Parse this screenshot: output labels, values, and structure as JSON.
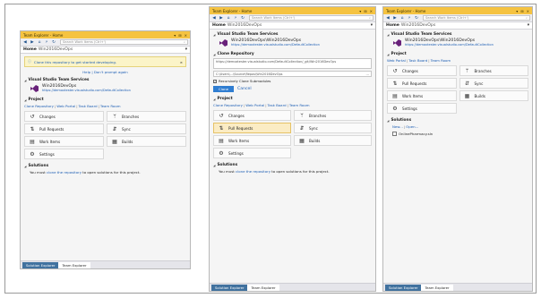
{
  "colors": {
    "title_bar": "#f5c341",
    "accent": "#2f7dd1",
    "link": "#1e5fb4",
    "tab_inactive": "#41729f",
    "selected_tile": "#fbecc4"
  },
  "panel1": {
    "title": "Team Explorer - Home",
    "search_placeholder": "Search Work Items (Ctrl+')",
    "home_label": "Home",
    "home_project": "Win2016DevOps",
    "notice": {
      "text": "Clone this repository to get started developing."
    },
    "help_links": "Help | Don't prompt again",
    "vsts": {
      "title": "Visual Studio Team Services",
      "project": "Win2016DevOps",
      "url": "https://demoxtester.visualstudio.com/DefaultCollection"
    },
    "project": {
      "title": "Project",
      "links": [
        "Clone Repository",
        "Web Portal",
        "Task Board",
        "Team Room"
      ],
      "tiles": [
        {
          "icon": "changes-icon",
          "glyph": "↺",
          "label": "Changes"
        },
        {
          "icon": "branches-icon",
          "glyph": "ᛘ",
          "label": "Branches"
        },
        {
          "icon": "pull-requests-icon",
          "glyph": "⇅",
          "label": "Pull Requests"
        },
        {
          "icon": "sync-icon",
          "glyph": "⇵",
          "label": "Sync"
        },
        {
          "icon": "work-items-icon",
          "glyph": "▤",
          "label": "Work Items"
        },
        {
          "icon": "builds-icon",
          "glyph": "▦",
          "label": "Builds"
        },
        {
          "icon": "settings-icon",
          "glyph": "⚙",
          "label": "Settings"
        }
      ]
    },
    "solutions": {
      "title": "Solutions",
      "text_before": "You must",
      "link": "clone the repository",
      "text_after": "to open solutions for this project."
    },
    "tabs": [
      "Solution Explorer",
      "Team Explorer"
    ]
  },
  "panel2": {
    "title": "Team Explorer - Home",
    "search_placeholder": "Search Work Items (Ctrl+')",
    "home_label": "Home",
    "home_project": "Win2016DevOps",
    "vsts": {
      "title": "Visual Studio Team Services",
      "project": "Win2016DevOps\\Win2016DevOps",
      "url": "https://demoxtester.visualstudio.com/DefaultCollection"
    },
    "clone": {
      "title": "Clone Repository",
      "url_value": "https://demoxtester.visualstudio.com/DefaultCollection/_git/Win2016DevOps",
      "path_value": "C:\\Users\\...\\Source\\Repos\\Win2016DevOps",
      "checkbox_label": "Recursively Clone Submodules",
      "clone_button": "Clone",
      "cancel_link": "Cancel"
    },
    "project": {
      "title": "Project",
      "links": [
        "Clone Repository",
        "Web Portal",
        "Task Board",
        "Team Room"
      ],
      "tiles": [
        {
          "icon": "changes-icon",
          "glyph": "↺",
          "label": "Changes"
        },
        {
          "icon": "branches-icon",
          "glyph": "ᛘ",
          "label": "Branches"
        },
        {
          "icon": "pull-requests-icon",
          "glyph": "⇅",
          "label": "Pull Requests"
        },
        {
          "icon": "sync-icon",
          "glyph": "⇵",
          "label": "Sync"
        },
        {
          "icon": "work-items-icon",
          "glyph": "▤",
          "label": "Work Items"
        },
        {
          "icon": "builds-icon",
          "glyph": "▦",
          "label": "Builds"
        },
        {
          "icon": "settings-icon",
          "glyph": "⚙",
          "label": "Settings"
        }
      ]
    },
    "solutions": {
      "title": "Solutions",
      "text_before": "You must",
      "link": "clone the repository",
      "text_after": "to open solutions for this project."
    },
    "tabs": [
      "Solution Explorer",
      "Team Explorer"
    ]
  },
  "panel3": {
    "title": "Team Explorer - Home",
    "search_placeholder": "Search Work Items (Ctrl+')",
    "home_label": "Home",
    "home_project": "Win2016DevOps",
    "vsts": {
      "title": "Visual Studio Team Services",
      "project": "Win2016DevOps\\Win2016DevOps",
      "url": "https://demoxtester.visualstudio.com/DefaultCollection"
    },
    "project": {
      "title": "Project",
      "links": [
        "Web Portal",
        "Task Board",
        "Team Room"
      ],
      "tiles": [
        {
          "icon": "changes-icon",
          "glyph": "↺",
          "label": "Changes"
        },
        {
          "icon": "branches-icon",
          "glyph": "ᛘ",
          "label": "Branches"
        },
        {
          "icon": "pull-requests-icon",
          "glyph": "⇅",
          "label": "Pull Requests"
        },
        {
          "icon": "sync-icon",
          "glyph": "⇵",
          "label": "Sync"
        },
        {
          "icon": "work-items-icon",
          "glyph": "▤",
          "label": "Work Items"
        },
        {
          "icon": "builds-icon",
          "glyph": "▦",
          "label": "Builds"
        },
        {
          "icon": "settings-icon",
          "glyph": "⚙",
          "label": "Settings"
        }
      ]
    },
    "solutions": {
      "title": "Solutions",
      "links": [
        "New...",
        "Open..."
      ],
      "item": "OnlinePharmacy.sln"
    },
    "tabs": [
      "Solution Explorer",
      "Team Explorer"
    ]
  }
}
